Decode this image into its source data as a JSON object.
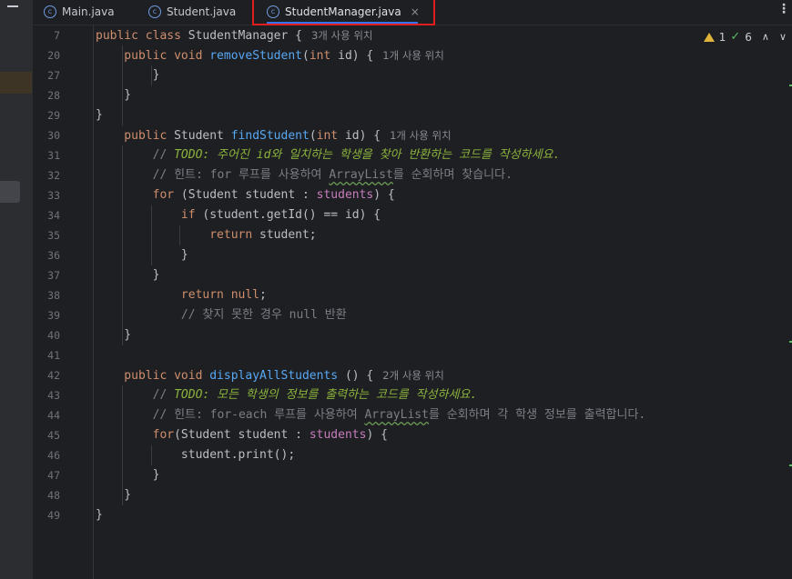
{
  "tabs": [
    {
      "label": "Main.java",
      "active": false
    },
    {
      "label": "Student.java",
      "active": false
    },
    {
      "label": "StudentManager.java",
      "active": true
    }
  ],
  "tab_close_glyph": "×",
  "more_glyph": "⋮",
  "class_icon_letter": "c",
  "inspections": {
    "warnings": "1",
    "checks": "6"
  },
  "colors": {
    "keyword": "#cf8e6d",
    "method": "#56a8f5",
    "field": "#c77dbb",
    "comment": "#7a7e85",
    "todo": "#8bb33d",
    "highlight_box": "#e01e1e",
    "accent": "#3574f0"
  },
  "lines": [
    {
      "no": "7",
      "segments": [
        {
          "t": "public class ",
          "c": "kw"
        },
        {
          "t": "StudentManager {",
          "c": ""
        },
        {
          "t": "3개 사용 위치",
          "c": "hint"
        }
      ]
    },
    {
      "no": "20",
      "segments": [
        {
          "t": "    public void ",
          "c": "kw"
        },
        {
          "t": "removeStudent",
          "c": "fn"
        },
        {
          "t": "(",
          "c": ""
        },
        {
          "t": "int ",
          "c": "kw"
        },
        {
          "t": "id) {",
          "c": ""
        },
        {
          "t": "1개 사용 위치",
          "c": "hint"
        }
      ]
    },
    {
      "no": "27",
      "segments": [
        {
          "t": "        }",
          "c": ""
        }
      ]
    },
    {
      "no": "28",
      "segments": [
        {
          "t": "    }",
          "c": ""
        }
      ]
    },
    {
      "no": "29",
      "segments": [
        {
          "t": "}",
          "c": ""
        }
      ]
    },
    {
      "no": "30",
      "segments": [
        {
          "t": "    public ",
          "c": "kw"
        },
        {
          "t": "Student ",
          "c": ""
        },
        {
          "t": "findStudent",
          "c": "fn"
        },
        {
          "t": "(",
          "c": ""
        },
        {
          "t": "int ",
          "c": "kw"
        },
        {
          "t": "id) {",
          "c": ""
        },
        {
          "t": "1개 사용 위치",
          "c": "hint"
        }
      ]
    },
    {
      "no": "31",
      "segments": [
        {
          "t": "        // ",
          "c": "cm"
        },
        {
          "t": "TODO: 주어진 id와 일치하는 학생을 찾아 반환하는 코드를 작성하세요.",
          "c": "todo"
        }
      ]
    },
    {
      "no": "32",
      "segments": [
        {
          "t": "        // 힌트: for 루프를 사용하여 ",
          "c": "cm"
        },
        {
          "t": "ArrayList",
          "c": "cm wavy"
        },
        {
          "t": "를 순회하며 찾습니다.",
          "c": "cm"
        }
      ]
    },
    {
      "no": "33",
      "segments": [
        {
          "t": "        for ",
          "c": "kw"
        },
        {
          "t": "(Student student : ",
          "c": ""
        },
        {
          "t": "students",
          "c": "field"
        },
        {
          "t": ") {",
          "c": ""
        }
      ]
    },
    {
      "no": "34",
      "segments": [
        {
          "t": "            if ",
          "c": "kw"
        },
        {
          "t": "(student.getId() == id) {",
          "c": ""
        }
      ]
    },
    {
      "no": "35",
      "segments": [
        {
          "t": "                return ",
          "c": "kw"
        },
        {
          "t": "student;",
          "c": ""
        }
      ]
    },
    {
      "no": "36",
      "segments": [
        {
          "t": "            }",
          "c": ""
        }
      ]
    },
    {
      "no": "37",
      "segments": [
        {
          "t": "        }",
          "c": ""
        }
      ]
    },
    {
      "no": "38",
      "segments": [
        {
          "t": "            return null",
          "c": "kw"
        },
        {
          "t": ";",
          "c": ""
        }
      ]
    },
    {
      "no": "39",
      "segments": [
        {
          "t": "            // 찾지 못한 경우 null 반환",
          "c": "cm"
        }
      ]
    },
    {
      "no": "40",
      "segments": [
        {
          "t": "    }",
          "c": ""
        }
      ]
    },
    {
      "no": "41",
      "segments": [
        {
          "t": "",
          "c": ""
        }
      ]
    },
    {
      "no": "42",
      "segments": [
        {
          "t": "    public void ",
          "c": "kw"
        },
        {
          "t": "displayAllStudents",
          "c": "fn"
        },
        {
          "t": " () {",
          "c": ""
        },
        {
          "t": "2개 사용 위치",
          "c": "hint"
        }
      ]
    },
    {
      "no": "43",
      "segments": [
        {
          "t": "        // ",
          "c": "cm"
        },
        {
          "t": "TODO: 모든 학생의 정보를 출력하는 코드를 작성하세요.",
          "c": "todo"
        }
      ]
    },
    {
      "no": "44",
      "segments": [
        {
          "t": "        // 힌트: for-each 루프를 사용하여 ",
          "c": "cm"
        },
        {
          "t": "ArrayList",
          "c": "cm wavy"
        },
        {
          "t": "를 순회하며 각 학생 정보를 출력합니다.",
          "c": "cm"
        }
      ]
    },
    {
      "no": "45",
      "segments": [
        {
          "t": "        for",
          "c": "kw"
        },
        {
          "t": "(Student student : ",
          "c": ""
        },
        {
          "t": "students",
          "c": "field"
        },
        {
          "t": ") {",
          "c": ""
        }
      ]
    },
    {
      "no": "46",
      "segments": [
        {
          "t": "            student.print();",
          "c": ""
        }
      ]
    },
    {
      "no": "47",
      "segments": [
        {
          "t": "        }",
          "c": ""
        }
      ]
    },
    {
      "no": "48",
      "segments": [
        {
          "t": "    }",
          "c": ""
        }
      ]
    },
    {
      "no": "49",
      "segments": [
        {
          "t": "}",
          "c": ""
        }
      ]
    }
  ]
}
